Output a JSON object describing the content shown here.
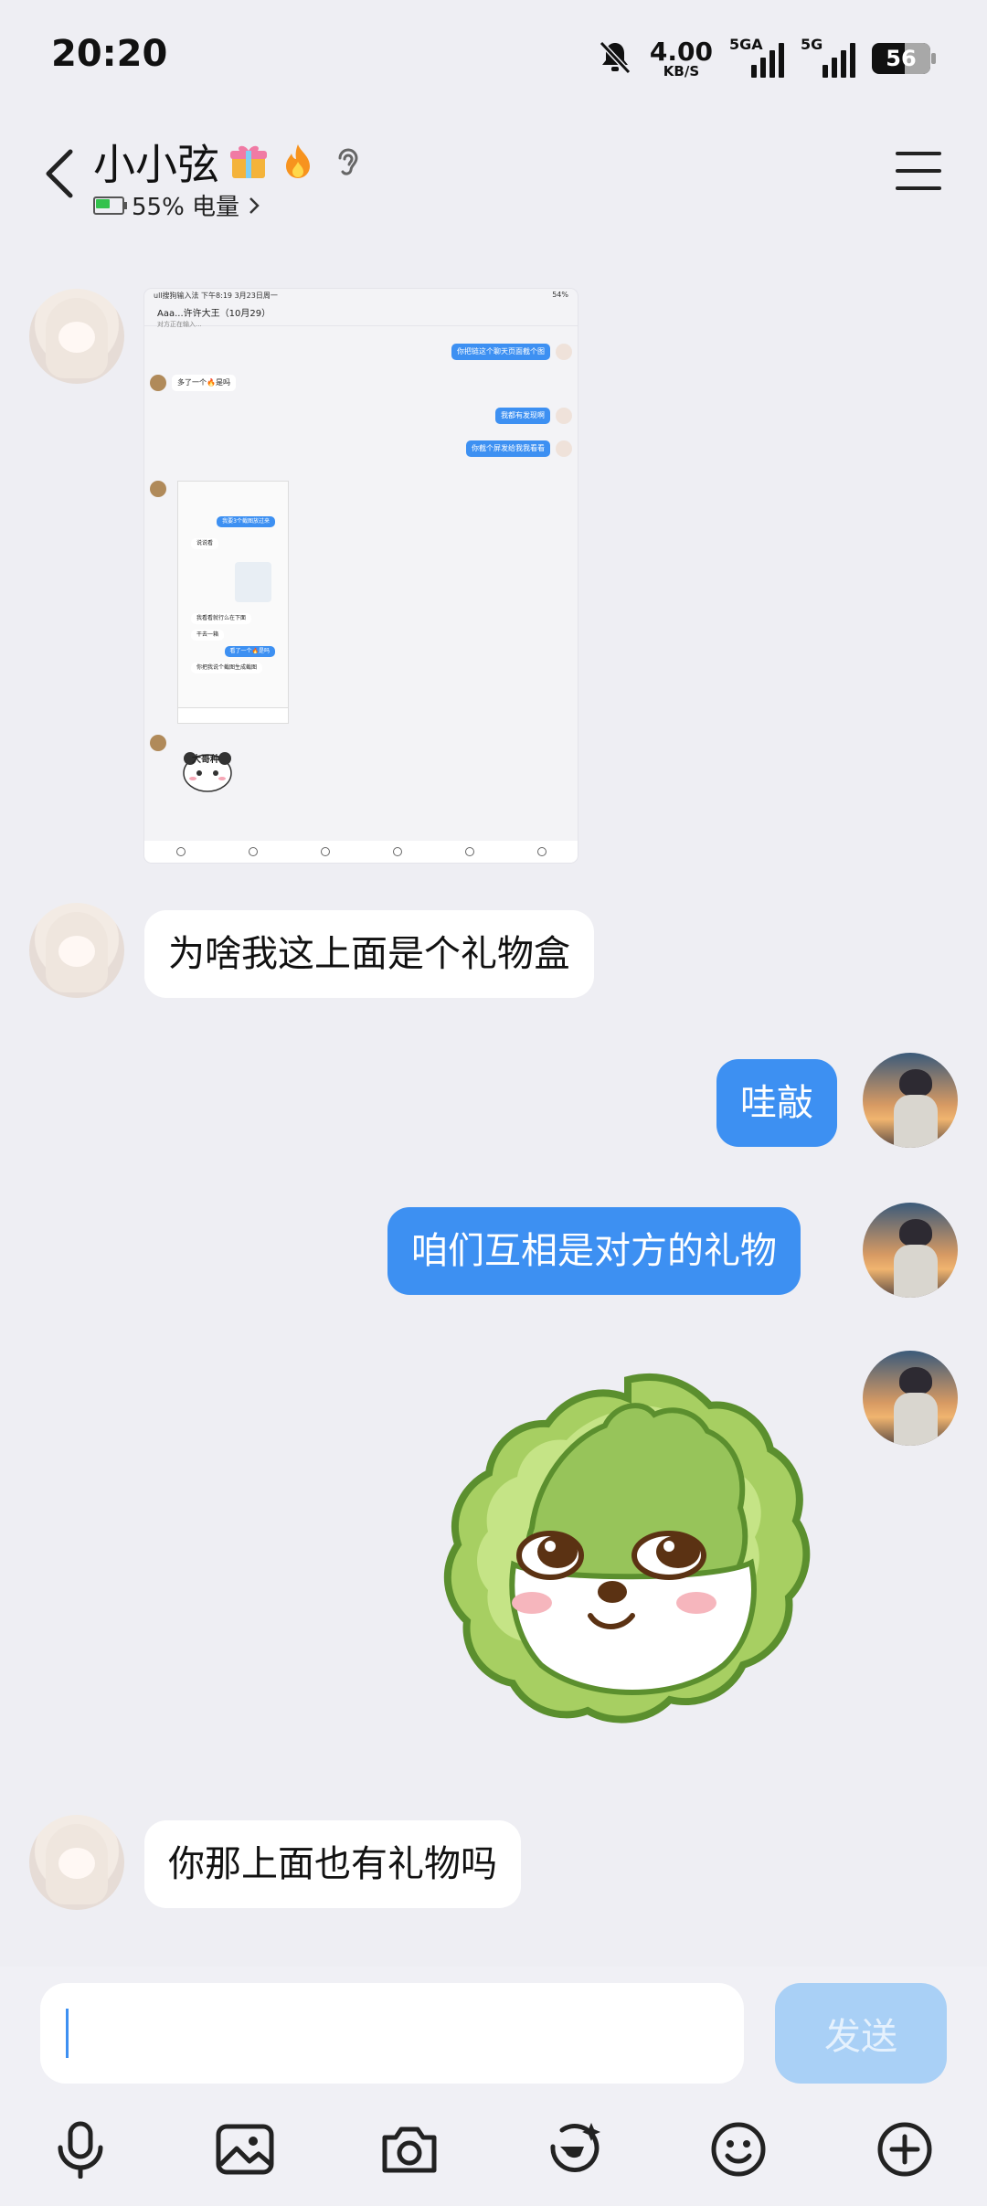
{
  "status": {
    "time": "20:20",
    "speed_value": "4.00",
    "speed_unit": "KB/S",
    "sim1_label": "5GA",
    "sim2_label": "5G",
    "battery": "56",
    "icons": [
      "bell-muted-icon",
      "signal-icon",
      "battery-icon"
    ]
  },
  "header": {
    "title": "小小弦",
    "badges": [
      "gift-icon",
      "flame-icon",
      "ear-icon"
    ],
    "battery_text": "55% 电量",
    "back_icon": "chevron-left-icon",
    "menu_icon": "menu-icon"
  },
  "screenshot_message": {
    "status_text": "ull搜狗输入法 下午8:19 3月23日周一",
    "status_right": "54%",
    "title": "Aaa...许许大王（10月29）",
    "subtitle": "对方正在输入...",
    "bubbles_out": [
      "你把链这个聊天页面截个图",
      "我都有发现啊",
      "你截个屏发给我我看看"
    ],
    "bubble_in": "多了一个🔥是吗",
    "nested": {
      "bubbles_out": [
        "我要3个截图放过来",
        "看了一个🔥是吗"
      ],
      "bubbles_in": [
        "说说看",
        "我看看就行么在下面",
        "干去一箱",
        "你把我说个截图生成截图"
      ]
    },
    "sticker_label": "大哥种"
  },
  "messages": [
    {
      "side": "in",
      "text": "为啥我这上面是个礼物盒"
    },
    {
      "side": "out",
      "text": "哇敲"
    },
    {
      "side": "out",
      "text": "咱们互相是对方的礼物"
    },
    {
      "side": "out",
      "type": "sticker",
      "description": "cabbage-dog-sticker"
    },
    {
      "side": "in",
      "text": "你那上面也有礼物吗"
    }
  ],
  "input": {
    "value": "",
    "placeholder": "",
    "send_label": "发送"
  },
  "toolbar": {
    "items": [
      "mic-icon",
      "image-icon",
      "camera-icon",
      "ai-sparkle-icon",
      "emoji-icon",
      "plus-circle-icon"
    ]
  },
  "colors": {
    "accent": "#3d90f2",
    "background": "#eeeef3",
    "send_disabled": "#a9d0f6"
  }
}
